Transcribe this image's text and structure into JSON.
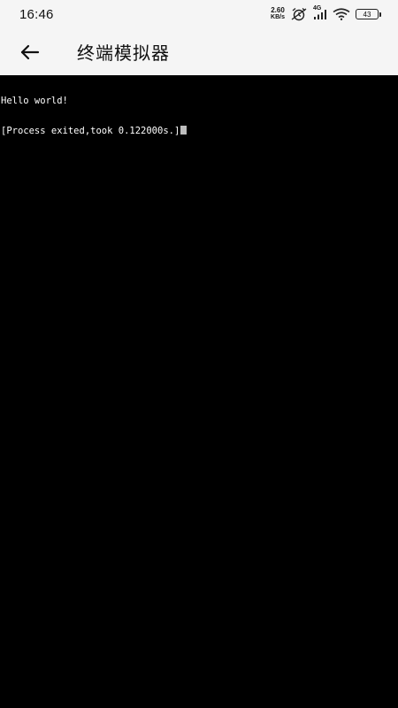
{
  "status_bar": {
    "time": "16:46",
    "net_speed_value": "2.60",
    "net_speed_unit": "KB/s",
    "network_type": "4G",
    "battery_level": "43",
    "icons": [
      "alarm-off-icon",
      "signal-icon",
      "wifi-icon",
      "battery-icon"
    ]
  },
  "app_bar": {
    "back_icon": "arrow-left-icon",
    "title": "终端模拟器"
  },
  "terminal": {
    "lines": [
      "Hello world!",
      "[Process exited,took 0.122000s.]"
    ],
    "cursor_color": "#bdbdbd"
  },
  "colors": {
    "bar_background": "#f5f5f5",
    "terminal_background": "#000000",
    "terminal_text": "#ffffff"
  }
}
